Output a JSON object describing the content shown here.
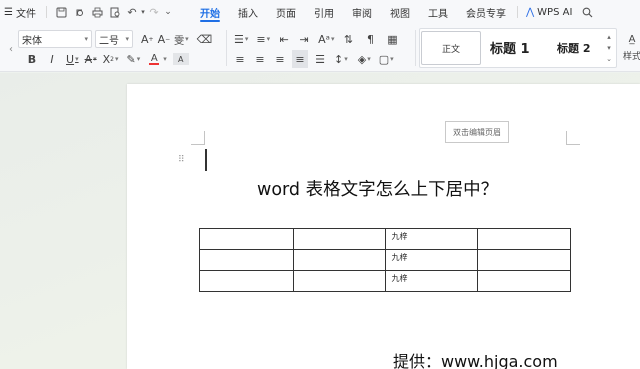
{
  "menubar": {
    "file_label": "文件",
    "tabs": [
      {
        "label": "开始",
        "active": true
      },
      {
        "label": "插入",
        "active": false
      },
      {
        "label": "页面",
        "active": false
      },
      {
        "label": "引用",
        "active": false
      },
      {
        "label": "审阅",
        "active": false
      },
      {
        "label": "视图",
        "active": false
      },
      {
        "label": "工具",
        "active": false
      },
      {
        "label": "会员专享",
        "active": false
      }
    ],
    "wps_ai_label": "WPS AI"
  },
  "ribbon": {
    "font_name": "宋体",
    "font_size": "二号",
    "styles": {
      "normal": "正文",
      "heading1": "标题 1",
      "heading2": "标题 2",
      "style_set": "样式"
    }
  },
  "document": {
    "header_hint": "双击编辑页眉",
    "title": "word 表格文字怎么上下居中？",
    "table": {
      "rows": [
        [
          "",
          "",
          "九梓",
          ""
        ],
        [
          "",
          "",
          "九梓",
          ""
        ],
        [
          "",
          "",
          "九梓",
          ""
        ]
      ]
    },
    "watermark": "提供：www.hjga.com"
  },
  "colors": {
    "accent": "#1f6fe5",
    "ribbon_bg": "#f7f8fa",
    "page_bg": "#ffffff"
  }
}
